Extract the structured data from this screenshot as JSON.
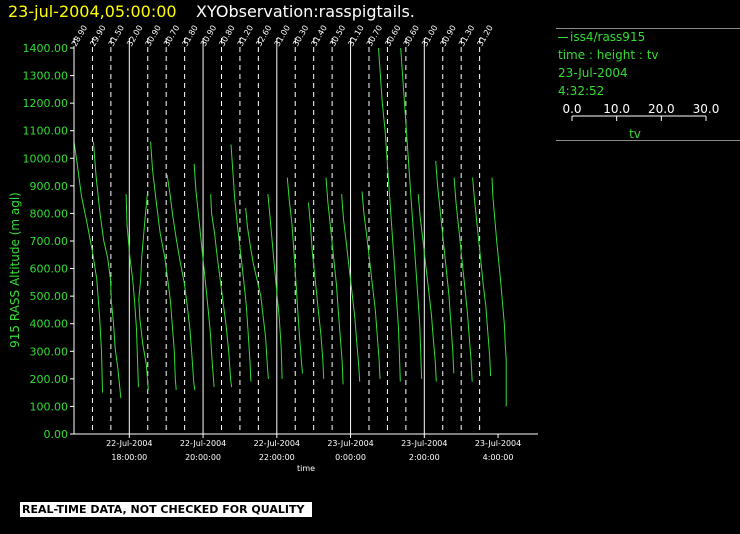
{
  "header": {
    "date_label": "23-jul-2004,05:00:00",
    "observation_label": "XYObservation:rasspigtails."
  },
  "legend": {
    "series_label": "iss4/rass915",
    "desc": "time : height : tv",
    "date": "23-Jul-2004",
    "time": "4:32:52",
    "scale_ticks": [
      "0.0",
      "10.0",
      "20.0",
      "30.0"
    ],
    "scale_min": 0,
    "scale_max": 30,
    "scale_label": "tv"
  },
  "footer": {
    "qc_note": "REAL-TIME DATA, NOT CHECKED FOR QUALITY"
  },
  "colors": {
    "background": "#000000",
    "trace": "#33dd33",
    "axis": "#ffffff",
    "title_date": "#ffff00",
    "legend": "#33dd33"
  },
  "chart_data": {
    "type": "line",
    "ylabel": "915 RASS Altitude (m agl)",
    "xlabel": "time",
    "ylim": [
      0,
      1400
    ],
    "yticks": [
      0,
      100,
      200,
      300,
      400,
      500,
      600,
      700,
      800,
      900,
      1000,
      1100,
      1200,
      1300,
      1400
    ],
    "ytick_labels": [
      "0.00",
      "100.00",
      "200.00",
      "300.00",
      "400.00",
      "500.00",
      "600.00",
      "700.00",
      "800.00",
      "900.00",
      "1000.00",
      "1100.00",
      "1200.00",
      "1300.00",
      "1400.00"
    ],
    "xlim": [
      "2004-07-22 16:30",
      "2004-07-23 05:05"
    ],
    "xticks": [
      {
        "date": "22-Jul-2004",
        "time": "18:00:00"
      },
      {
        "date": "22-Jul-2004",
        "time": "20:00:00"
      },
      {
        "date": "22-Jul-2004",
        "time": "22:00:00"
      },
      {
        "date": "23-Jul-2004",
        "time": "0:00:00"
      },
      {
        "date": "23-Jul-2004",
        "time": "2:00:00"
      },
      {
        "date": "23-Jul-2004",
        "time": "4:00:00"
      }
    ],
    "profiles": [
      {
        "time": "2004-07-22 16:30",
        "top_label": "28.90",
        "points": [
          [
            0,
            1060
          ],
          [
            3,
            990
          ],
          [
            8,
            860
          ],
          [
            14,
            760
          ],
          [
            20,
            650
          ],
          [
            24,
            560
          ],
          [
            27,
            420
          ],
          [
            29,
            300
          ],
          [
            30,
            150
          ]
        ]
      },
      {
        "time": "2004-07-22 17:00",
        "top_label": "29.90",
        "points": [
          [
            1,
            1060
          ],
          [
            4,
            930
          ],
          [
            8,
            800
          ],
          [
            12,
            700
          ],
          [
            16,
            640
          ],
          [
            19,
            560
          ],
          [
            20,
            480
          ],
          [
            22,
            410
          ],
          [
            24,
            310
          ],
          [
            27,
            230
          ],
          [
            29,
            160
          ],
          [
            30,
            130
          ]
        ]
      },
      {
        "time": "2004-07-22 17:30",
        "top_label": "31.50",
        "points": [
          [
            16,
            870
          ],
          [
            17,
            760
          ],
          [
            20,
            640
          ],
          [
            23,
            560
          ],
          [
            25,
            480
          ],
          [
            27,
            380
          ],
          [
            28,
            270
          ],
          [
            29,
            170
          ]
        ]
      },
      {
        "time": "2004-07-22 18:00",
        "top_label": "32.00",
        "points": [
          [
            19,
            870
          ],
          [
            17,
            800
          ],
          [
            15,
            720
          ],
          [
            13,
            640
          ],
          [
            12,
            560
          ],
          [
            10,
            490
          ],
          [
            11,
            420
          ],
          [
            14,
            330
          ],
          [
            18,
            250
          ],
          [
            20,
            160
          ]
        ]
      },
      {
        "time": "2004-07-22 18:30",
        "top_label": "30.90",
        "points": [
          [
            3,
            1060
          ],
          [
            5,
            960
          ],
          [
            9,
            840
          ],
          [
            13,
            730
          ],
          [
            18,
            640
          ],
          [
            21,
            560
          ],
          [
            24,
            480
          ],
          [
            26,
            390
          ],
          [
            28,
            300
          ],
          [
            29,
            200
          ],
          [
            30,
            160
          ]
        ]
      },
      {
        "time": "2004-07-22 19:00",
        "top_label": "30.70",
        "points": [
          [
            1,
            940
          ],
          [
            4,
            870
          ],
          [
            7,
            790
          ],
          [
            11,
            700
          ],
          [
            15,
            620
          ],
          [
            19,
            550
          ],
          [
            22,
            470
          ],
          [
            25,
            380
          ],
          [
            27,
            290
          ],
          [
            29,
            190
          ],
          [
            30,
            160
          ]
        ]
      },
      {
        "time": "2004-07-22 19:30",
        "top_label": "31.80",
        "points": [
          [
            10,
            980
          ],
          [
            12,
            880
          ],
          [
            15,
            780
          ],
          [
            18,
            680
          ],
          [
            21,
            580
          ],
          [
            24,
            480
          ],
          [
            27,
            370
          ],
          [
            29,
            260
          ],
          [
            31,
            170
          ]
        ]
      },
      {
        "time": "2004-07-22 20:00",
        "top_label": "30.90",
        "points": [
          [
            8,
            870
          ],
          [
            9,
            800
          ],
          [
            12,
            730
          ],
          [
            15,
            640
          ],
          [
            18,
            560
          ],
          [
            21,
            480
          ],
          [
            24,
            400
          ],
          [
            27,
            300
          ],
          [
            29,
            200
          ],
          [
            30,
            170
          ]
        ]
      },
      {
        "time": "2004-07-22 20:30",
        "top_label": "30.80",
        "points": [
          [
            10,
            1050
          ],
          [
            12,
            950
          ],
          [
            14,
            850
          ],
          [
            17,
            750
          ],
          [
            20,
            660
          ],
          [
            23,
            570
          ],
          [
            26,
            470
          ],
          [
            28,
            370
          ],
          [
            30,
            260
          ],
          [
            31,
            190
          ]
        ]
      },
      {
        "time": "2004-07-22 21:00",
        "top_label": "31.20",
        "points": [
          [
            6,
            820
          ],
          [
            8,
            750
          ],
          [
            11,
            680
          ],
          [
            14,
            620
          ],
          [
            18,
            560
          ],
          [
            22,
            500
          ],
          [
            24,
            440
          ],
          [
            27,
            350
          ],
          [
            29,
            240
          ],
          [
            30,
            200
          ]
        ]
      },
      {
        "time": "2004-07-22 21:30",
        "top_label": "32.60",
        "points": [
          [
            10,
            870
          ],
          [
            13,
            760
          ],
          [
            16,
            640
          ],
          [
            19,
            530
          ],
          [
            22,
            420
          ],
          [
            24,
            310
          ],
          [
            25,
            200
          ]
        ]
      },
      {
        "time": "2004-07-22 22:00",
        "top_label": "31.00",
        "points": [
          [
            11,
            930
          ],
          [
            13,
            850
          ],
          [
            16,
            760
          ],
          [
            18,
            660
          ],
          [
            20,
            560
          ],
          [
            22,
            450
          ],
          [
            24,
            350
          ],
          [
            26,
            260
          ],
          [
            27,
            220
          ]
        ]
      },
      {
        "time": "2004-07-22 22:30",
        "top_label": "30.30",
        "points": [
          [
            14,
            840
          ],
          [
            16,
            760
          ],
          [
            18,
            660
          ],
          [
            21,
            560
          ],
          [
            24,
            460
          ],
          [
            27,
            360
          ],
          [
            29,
            270
          ],
          [
            30,
            200
          ]
        ]
      },
      {
        "time": "2004-07-22 23:00",
        "top_label": "31.40",
        "points": [
          [
            13,
            930
          ],
          [
            15,
            840
          ],
          [
            18,
            740
          ],
          [
            21,
            640
          ],
          [
            24,
            540
          ],
          [
            26,
            440
          ],
          [
            28,
            350
          ],
          [
            30,
            260
          ],
          [
            31,
            180
          ]
        ]
      },
      {
        "time": "2004-07-22 23:30",
        "top_label": "30.50",
        "points": [
          [
            10,
            870
          ],
          [
            12,
            780
          ],
          [
            15,
            690
          ],
          [
            18,
            600
          ],
          [
            21,
            510
          ],
          [
            24,
            420
          ],
          [
            26,
            330
          ],
          [
            28,
            250
          ],
          [
            29,
            190
          ]
        ]
      },
      {
        "time": "2004-07-23 00:00",
        "top_label": "31.10",
        "points": [
          [
            12,
            880
          ],
          [
            14,
            800
          ],
          [
            17,
            720
          ],
          [
            20,
            630
          ],
          [
            23,
            540
          ],
          [
            26,
            450
          ],
          [
            28,
            360
          ],
          [
            30,
            270
          ],
          [
            31,
            200
          ]
        ]
      },
      {
        "time": "2004-07-23 00:30",
        "top_label": "30.70",
        "points": [
          [
            10,
            1400
          ],
          [
            12,
            1300
          ],
          [
            14,
            1200
          ],
          [
            17,
            1100
          ],
          [
            19,
            1000
          ],
          [
            21,
            900
          ],
          [
            23,
            800
          ],
          [
            25,
            700
          ],
          [
            27,
            600
          ],
          [
            29,
            490
          ],
          [
            31,
            390
          ],
          [
            32,
            290
          ],
          [
            33,
            190
          ]
        ]
      },
      {
        "time": "2004-07-23 01:00",
        "top_label": "30.60",
        "points": [
          [
            14,
            1400
          ],
          [
            16,
            1300
          ],
          [
            18,
            1200
          ],
          [
            20,
            1100
          ],
          [
            22,
            1000
          ],
          [
            24,
            900
          ],
          [
            26,
            800
          ],
          [
            28,
            700
          ],
          [
            30,
            600
          ],
          [
            32,
            500
          ],
          [
            34,
            400
          ],
          [
            35,
            300
          ],
          [
            36,
            200
          ]
        ]
      },
      {
        "time": "2004-07-23 01:30",
        "top_label": "30.60",
        "points": [
          [
            13,
            870
          ],
          [
            15,
            790
          ],
          [
            18,
            700
          ],
          [
            21,
            610
          ],
          [
            24,
            520
          ],
          [
            27,
            430
          ],
          [
            29,
            340
          ],
          [
            31,
            260
          ],
          [
            32,
            190
          ]
        ]
      },
      {
        "time": "2004-07-23 02:00",
        "top_label": "31.00",
        "points": [
          [
            12,
            990
          ],
          [
            14,
            900
          ],
          [
            17,
            800
          ],
          [
            20,
            700
          ],
          [
            23,
            600
          ],
          [
            26,
            500
          ],
          [
            28,
            400
          ],
          [
            30,
            300
          ],
          [
            31,
            220
          ]
        ]
      },
      {
        "time": "2004-07-23 02:30",
        "top_label": "30.90",
        "points": [
          [
            12,
            930
          ],
          [
            14,
            840
          ],
          [
            17,
            740
          ],
          [
            20,
            640
          ],
          [
            23,
            540
          ],
          [
            26,
            440
          ],
          [
            28,
            350
          ],
          [
            30,
            260
          ],
          [
            31,
            190
          ]
        ]
      },
      {
        "time": "2004-07-23 03:00",
        "top_label": "31.30",
        "points": [
          [
            12,
            930
          ],
          [
            14,
            850
          ],
          [
            17,
            750
          ],
          [
            20,
            650
          ],
          [
            23,
            550
          ],
          [
            26,
            460
          ],
          [
            28,
            370
          ],
          [
            30,
            280
          ],
          [
            31,
            210
          ]
        ]
      },
      {
        "time": "2004-07-23 03:30",
        "top_label": "31.20",
        "points": [
          [
            13,
            930
          ],
          [
            14,
            860
          ],
          [
            16,
            780
          ],
          [
            18,
            700
          ],
          [
            20,
            630
          ],
          [
            22,
            560
          ],
          [
            24,
            480
          ],
          [
            26,
            400
          ],
          [
            27,
            320
          ],
          [
            28,
            270
          ],
          [
            28,
            100
          ]
        ]
      }
    ]
  }
}
